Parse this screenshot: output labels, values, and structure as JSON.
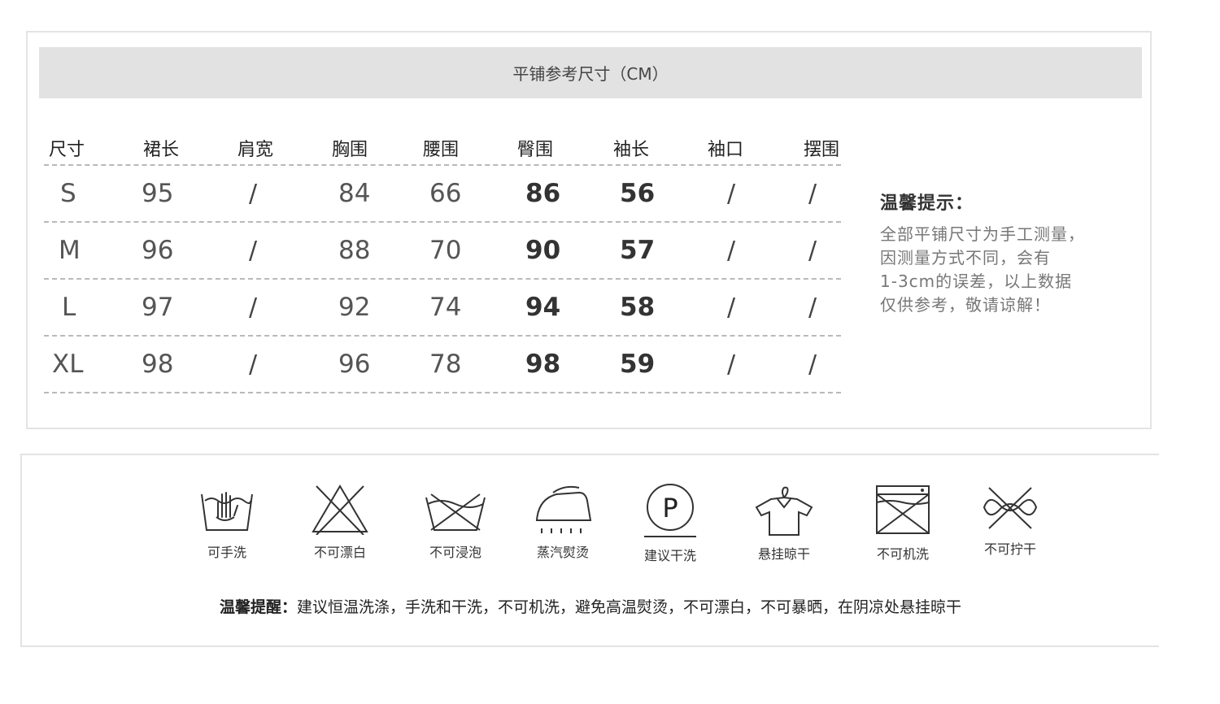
{
  "size_chart": {
    "title": "平铺参考尺寸（CM）",
    "headers": [
      "尺寸",
      "裙长",
      "肩宽",
      "胸围",
      "腰围",
      "臀围",
      "袖长",
      "袖口",
      "摆围"
    ],
    "rows": [
      [
        "S",
        "95",
        "/",
        "84",
        "66",
        "86",
        "56",
        "/",
        "/"
      ],
      [
        "M",
        "96",
        "/",
        "88",
        "70",
        "90",
        "57",
        "/",
        "/"
      ],
      [
        "L",
        "97",
        "/",
        "92",
        "74",
        "94",
        "58",
        "/",
        "/"
      ],
      [
        "XL",
        "98",
        "/",
        "96",
        "78",
        "98",
        "59",
        "/",
        "/"
      ]
    ]
  },
  "tip": {
    "title": "温馨提示：",
    "lines": [
      "全部平铺尺寸为手工测量，",
      "因测量方式不同，会有",
      "1-3cm的误差，以上数据",
      "仅供参考，敬请谅解！"
    ]
  },
  "care": {
    "items": [
      {
        "icon": "hand-wash-icon",
        "label": "可手洗"
      },
      {
        "icon": "no-bleach-icon",
        "label": "不可漂白"
      },
      {
        "icon": "no-soak-icon",
        "label": "不可浸泡"
      },
      {
        "icon": "steam-iron-icon",
        "label": "蒸汽熨烫"
      },
      {
        "icon": "dry-clean-p-icon",
        "label": "建议干洗"
      },
      {
        "icon": "hang-dry-icon",
        "label": "悬挂晾干"
      },
      {
        "icon": "no-machine-wash-icon",
        "label": "不可机洗"
      },
      {
        "icon": "no-wring-icon",
        "label": "不可拧干"
      }
    ],
    "note_label": "温馨提醒：",
    "note_text": "建议恒温洗涤，手洗和干洗，不可机洗，避免高温熨烫，不可漂白，不可暴晒，在阴凉处悬挂晾干"
  }
}
